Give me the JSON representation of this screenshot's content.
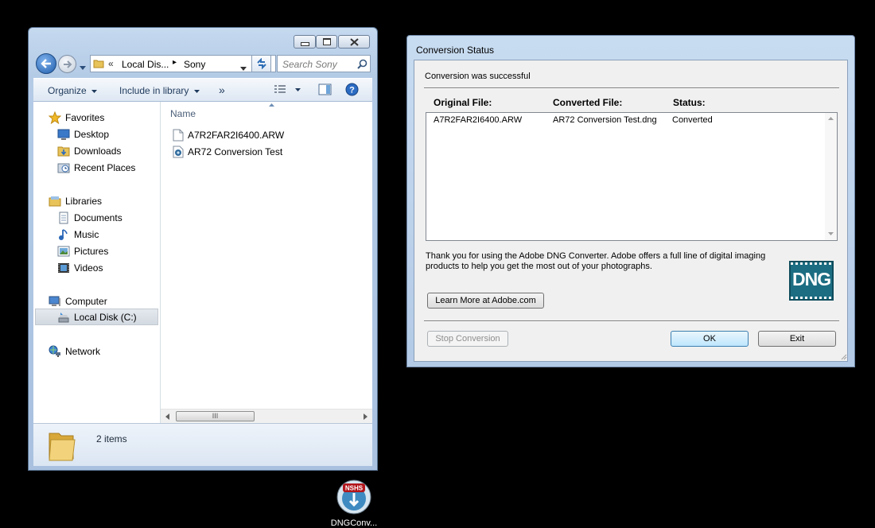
{
  "explorer": {
    "breadcrumb": {
      "prefix": "«",
      "parent": "Local Dis...",
      "separator": "▸",
      "current": "Sony"
    },
    "search": {
      "placeholder": "Search Sony"
    },
    "toolbar": {
      "organize": "Organize",
      "include_in_library": "Include in library",
      "more": "»"
    },
    "nav": {
      "favorites": "Favorites",
      "favorites_items": [
        "Desktop",
        "Downloads",
        "Recent Places"
      ],
      "libraries": "Libraries",
      "libraries_items": [
        "Documents",
        "Music",
        "Pictures",
        "Videos"
      ],
      "computer": "Computer",
      "computer_items": [
        "Local Disk (C:)"
      ],
      "network": "Network"
    },
    "files": {
      "column_name": "Name",
      "items": [
        "A7R2FAR2I6400.ARW",
        "AR72 Conversion Test"
      ]
    },
    "scrollbar": {
      "thumb": "III"
    },
    "status": {
      "count": "2 items"
    }
  },
  "dialog": {
    "title": "Conversion Status",
    "message": "Conversion was successful",
    "columns": {
      "original": "Original File:",
      "converted": "Converted File:",
      "status": "Status:"
    },
    "rows": [
      {
        "original": "A7R2FAR2I6400.ARW",
        "converted": "AR72 Conversion Test.dng",
        "status": "Converted"
      }
    ],
    "thanks_line1": "Thank you for using the Adobe DNG Converter.  Adobe offers a full line of digital imaging",
    "thanks_line2": "products to help you get the most out of your photographs.",
    "logo_text": "DNG",
    "learn_more": "Learn More at Adobe.com",
    "stop": "Stop Conversion",
    "ok": "OK",
    "exit": "Exit"
  },
  "desktop": {
    "icon_label": "DNGConv...",
    "icon_badge": "NSHS"
  }
}
